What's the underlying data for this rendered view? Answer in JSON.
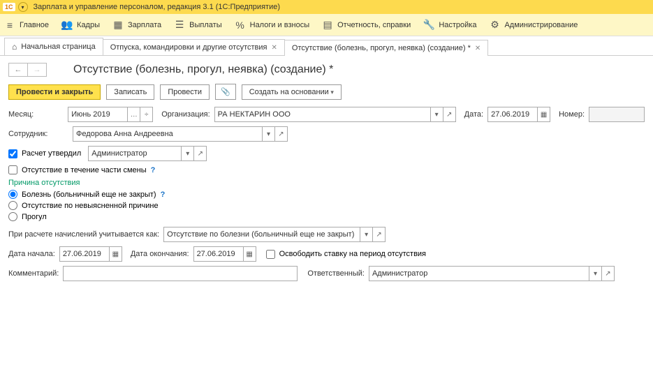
{
  "window": {
    "title": "Зарплата и управление персоналом, редакция 3.1  (1С:Предприятие)"
  },
  "menu": {
    "main": "Главное",
    "personnel": "Кадры",
    "salary": "Зарплата",
    "payments": "Выплаты",
    "taxes": "Налоги и взносы",
    "reports": "Отчетность, справки",
    "settings": "Настройка",
    "admin": "Администрирование"
  },
  "tabs": {
    "home": "Начальная страница",
    "t1": "Отпуска, командировки и другие отсутствия",
    "t2": "Отсутствие (болезнь, прогул, неявка) (создание) *"
  },
  "page": {
    "title": "Отсутствие (болезнь, прогул, неявка) (создание) *"
  },
  "toolbar": {
    "post_close": "Провести и закрыть",
    "save": "Записать",
    "post": "Провести",
    "create_based": "Создать на основании"
  },
  "labels": {
    "month": "Месяц:",
    "org": "Организация:",
    "date": "Дата:",
    "number": "Номер:",
    "employee": "Сотрудник:",
    "approved": "Расчет утвердил",
    "shift_part": "Отсутствие в течение части смены",
    "reason_section": "Причина отсутствия",
    "reason1": "Болезнь (больничный еще не закрыт)",
    "reason2": "Отсутствие по невыясненной причине",
    "reason3": "Прогул",
    "calc_as": "При расчете начислений учитывается как:",
    "date_start": "Дата начала:",
    "date_end": "Дата окончания:",
    "release_rate": "Освободить ставку на период отсутствия",
    "comment": "Комментарий:",
    "responsible": "Ответственный:"
  },
  "values": {
    "month": "Июнь 2019",
    "org": "РА НЕКТАРИН ООО",
    "date": "27.06.2019",
    "number": "",
    "employee": "Федорова Анна Андреевна",
    "approver": "Администратор",
    "calc_as": "Отсутствие по болезни (больничный еще не закрыт)",
    "date_start": "27.06.2019",
    "date_end": "27.06.2019",
    "comment": "",
    "responsible": "Администратор"
  }
}
